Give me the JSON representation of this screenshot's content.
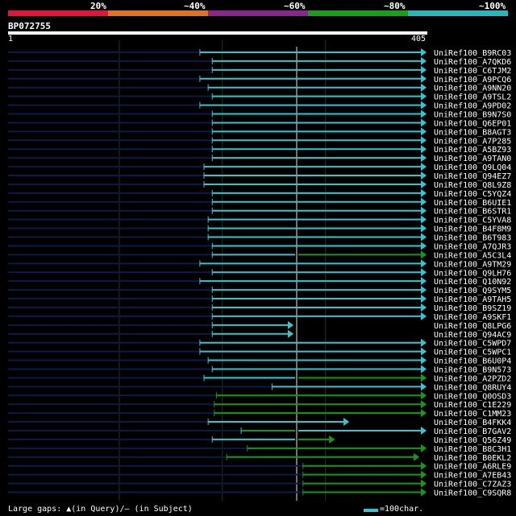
{
  "identity_legend": {
    "labels": [
      "20%",
      "~40%",
      "~60%",
      "~80%",
      "~100%"
    ],
    "colors": [
      "#e8133a",
      "#e2721d",
      "#8c238f",
      "#16a216",
      "#24b8bc"
    ]
  },
  "query": {
    "name": "BP072755",
    "start": "1",
    "end": "405"
  },
  "hits": [
    {
      "name": "UniRef100_B9RC03",
      "start": 186,
      "end": 405,
      "gap": false,
      "col": "cyan"
    },
    {
      "name": "UniRef100_A7QKD6",
      "start": 198,
      "end": 405,
      "gap": false,
      "col": "cyan"
    },
    {
      "name": "UniRef100_C6TJM2",
      "start": 198,
      "end": 405,
      "gap": false,
      "col": "cyan"
    },
    {
      "name": "UniRef100_A9PCQ6",
      "start": 186,
      "end": 405,
      "gap": false,
      "col": "cyan"
    },
    {
      "name": "UniRef100_A9NN20",
      "start": 194,
      "end": 405,
      "gap": false,
      "col": "cyan"
    },
    {
      "name": "UniRef100_A9TSL2",
      "start": 198,
      "end": 405,
      "gap": false,
      "col": "cyan"
    },
    {
      "name": "UniRef100_A9PD02",
      "start": 186,
      "end": 405,
      "gap": false,
      "col": "cyan"
    },
    {
      "name": "UniRef100_B9N7S0",
      "start": 198,
      "end": 405,
      "gap": false,
      "col": "cyan"
    },
    {
      "name": "UniRef100_Q6EP01",
      "start": 198,
      "end": 405,
      "gap": false,
      "col": "cyan"
    },
    {
      "name": "UniRef100_B8AGT3",
      "start": 198,
      "end": 405,
      "gap": false,
      "col": "cyan"
    },
    {
      "name": "UniRef100_A7P285",
      "start": 198,
      "end": 405,
      "gap": false,
      "col": "cyan"
    },
    {
      "name": "UniRef100_A5BZ93",
      "start": 198,
      "end": 405,
      "gap": false,
      "col": "cyan"
    },
    {
      "name": "UniRef100_A9TAN0",
      "start": 198,
      "end": 405,
      "gap": false,
      "col": "cyan"
    },
    {
      "name": "UniRef100_Q9LQ04",
      "start": 190,
      "end": 405,
      "gap": false,
      "col": "cyan"
    },
    {
      "name": "UniRef100_Q94EZ7",
      "start": 190,
      "end": 405,
      "gap": false,
      "col": "cyan"
    },
    {
      "name": "UniRef100_Q8L9Z8",
      "start": 190,
      "end": 405,
      "gap": false,
      "col": "cyan"
    },
    {
      "name": "UniRef100_C5YQZ4",
      "start": 198,
      "end": 405,
      "gap": false,
      "col": "cyan"
    },
    {
      "name": "UniRef100_B6UIE1",
      "start": 198,
      "end": 405,
      "gap": false,
      "col": "cyan"
    },
    {
      "name": "UniRef100_B6STR1",
      "start": 198,
      "end": 405,
      "gap": false,
      "col": "cyan"
    },
    {
      "name": "UniRef100_C5YVA8",
      "start": 194,
      "end": 405,
      "gap": false,
      "col": "cyan"
    },
    {
      "name": "UniRef100_B4F8M9",
      "start": 194,
      "end": 405,
      "gap": false,
      "col": "cyan"
    },
    {
      "name": "UniRef100_B6T983",
      "start": 194,
      "end": 405,
      "gap": false,
      "col": "cyan"
    },
    {
      "name": "UniRef100_A7QJR3",
      "start": 198,
      "end": 405,
      "gap": false,
      "col": "cyan"
    },
    {
      "name": "UniRef100_A5C3L4",
      "start": 198,
      "end": 405,
      "gap": false,
      "col": "mixed"
    },
    {
      "name": "UniRef100_A9TM29",
      "start": 186,
      "end": 405,
      "gap": false,
      "col": "cyan"
    },
    {
      "name": "UniRef100_Q9LH76",
      "start": 198,
      "end": 405,
      "gap": false,
      "col": "cyan"
    },
    {
      "name": "UniRef100_Q10N92",
      "start": 186,
      "end": 405,
      "gap": false,
      "col": "cyan"
    },
    {
      "name": "UniRef100_Q9SYM5",
      "start": 198,
      "end": 405,
      "gap": false,
      "col": "cyan"
    },
    {
      "name": "UniRef100_A9TAH5",
      "start": 198,
      "end": 405,
      "gap": false,
      "col": "cyan"
    },
    {
      "name": "UniRef100_B9SZ19",
      "start": 198,
      "end": 405,
      "gap": false,
      "col": "cyan"
    },
    {
      "name": "UniRef100_A9SKF1",
      "start": 198,
      "end": 405,
      "gap": false,
      "col": "cyan"
    },
    {
      "name": "UniRef100_Q8LPG6",
      "start": 198,
      "end": 276,
      "gap": false,
      "col": "cyan"
    },
    {
      "name": "UniRef100_Q94AC9",
      "start": 198,
      "end": 276,
      "gap": false,
      "col": "cyan"
    },
    {
      "name": "UniRef100_C5WPD7",
      "start": 186,
      "end": 405,
      "gap": false,
      "col": "cyan"
    },
    {
      "name": "UniRef100_C5WPC1",
      "start": 186,
      "end": 405,
      "gap": false,
      "col": "cyan"
    },
    {
      "name": "UniRef100_B6U0P4",
      "start": 194,
      "end": 405,
      "gap": false,
      "col": "cyan"
    },
    {
      "name": "UniRef100_B9N573",
      "start": 198,
      "end": 405,
      "gap": false,
      "col": "cyan"
    },
    {
      "name": "UniRef100_A2PZD2",
      "start": 190,
      "end": 405,
      "gap": false,
      "col": "mixed"
    },
    {
      "name": "UniRef100_Q8RUY4",
      "start": 256,
      "end": 405,
      "gap": false,
      "col": "cyan"
    },
    {
      "name": "UniRef100_Q0OSD3",
      "start": 202,
      "end": 405,
      "gap": false,
      "col": "green"
    },
    {
      "name": "UniRef100_C1E229",
      "start": 200,
      "end": 405,
      "gap": true,
      "col": "green"
    },
    {
      "name": "UniRef100_C1MM23",
      "start": 200,
      "end": 405,
      "gap": true,
      "col": "green"
    },
    {
      "name": "UniRef100_B4FKK4",
      "start": 194,
      "end": 330,
      "gap": false,
      "col": "cyan"
    },
    {
      "name": "UniRef100_B7GAV2",
      "start": 226,
      "end": 405,
      "gap": false,
      "col": "mixed2"
    },
    {
      "name": "UniRef100_Q56Z49",
      "start": 198,
      "end": 316,
      "gap": false,
      "col": "mixed"
    },
    {
      "name": "UniRef100_B8C3H1",
      "start": 232,
      "end": 405,
      "gap": false,
      "col": "green"
    },
    {
      "name": "UniRef100_B0EKL2",
      "start": 212,
      "end": 398,
      "gap": false,
      "col": "green"
    },
    {
      "name": "UniRef100_A6RLE9",
      "start": 286,
      "end": 405,
      "gap": false,
      "col": "green"
    },
    {
      "name": "UniRef100_A7EB43",
      "start": 286,
      "end": 405,
      "gap": false,
      "col": "green"
    },
    {
      "name": "UniRef100_C7ZAZ3",
      "start": 286,
      "end": 405,
      "gap": false,
      "col": "green"
    },
    {
      "name": "UniRef100_C9SQR8",
      "start": 286,
      "end": 405,
      "gap": false,
      "col": "green"
    }
  ],
  "footer": {
    "gaps_text": "Large gaps: ▲(in Query)/– (in Subject)",
    "scale_text": "=100char."
  },
  "colors": {
    "cyan": "#2fc7d2",
    "green": "#159a15",
    "navy": "#0b1a4a",
    "grid": "#1c3a1c"
  }
}
